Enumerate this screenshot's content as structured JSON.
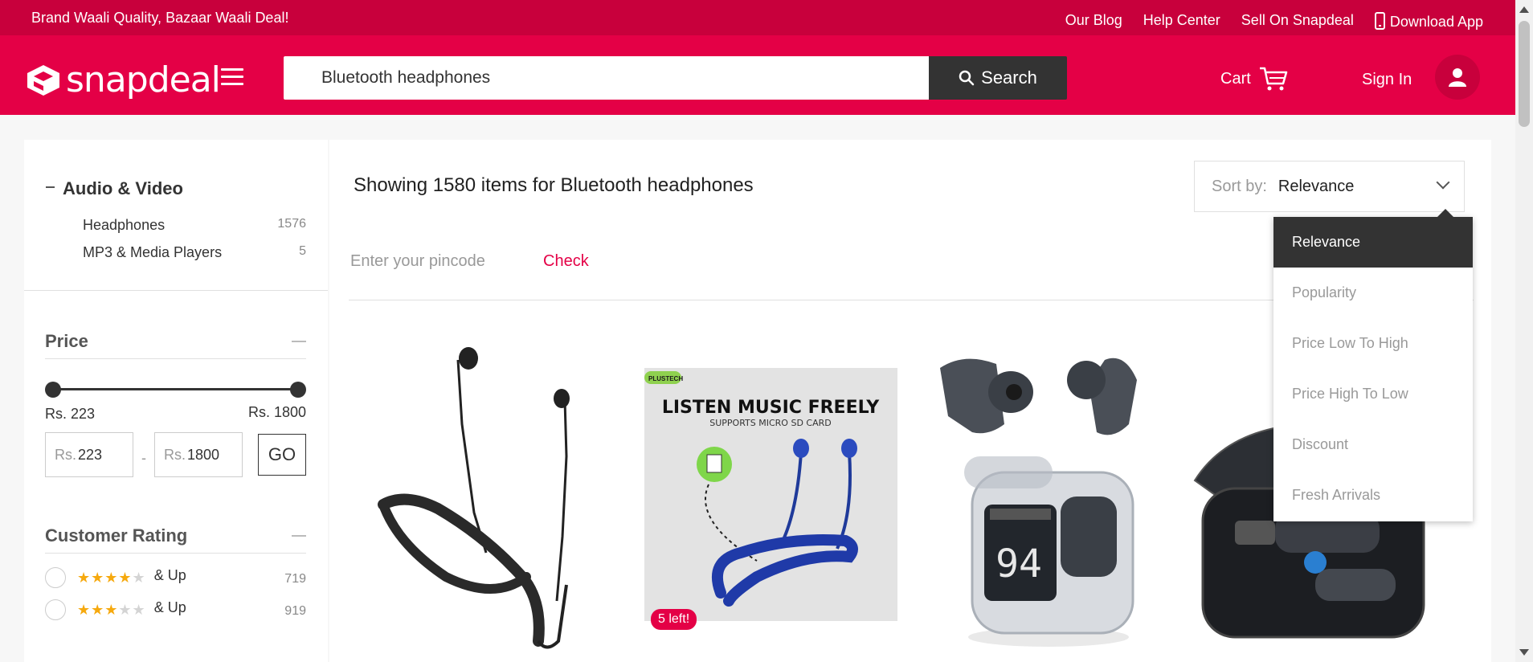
{
  "top_bar": {
    "tagline": "Brand Waali Quality, Bazaar Waali Deal!",
    "links": [
      "Our Blog",
      "Help Center",
      "Sell On Snapdeal",
      "Download App"
    ]
  },
  "header": {
    "logo_text": "snapdeal",
    "search_value": "Bluetooth headphones",
    "search_button": "Search",
    "cart_label": "Cart",
    "signin_label": "Sign In"
  },
  "sidebar": {
    "category": {
      "title": "Audio & Video",
      "items": [
        {
          "label": "Headphones",
          "count": "1576"
        },
        {
          "label": "MP3 & Media Players",
          "count": "5"
        }
      ]
    },
    "price": {
      "title": "Price",
      "min_label": "Rs. 223",
      "max_label": "Rs. 1800",
      "input_prefix": "Rs.",
      "min_value": "223",
      "max_value": "1800",
      "range_separator": "-",
      "go_label": "GO"
    },
    "rating": {
      "title": "Customer Rating",
      "rows": [
        {
          "stars": 4,
          "label": "& Up",
          "count": "719"
        },
        {
          "stars": 3,
          "label": "& Up",
          "count": "919"
        }
      ]
    }
  },
  "main": {
    "showing_text": "Showing 1580 items for Bluetooth headphones",
    "sort_label": "Sort by:",
    "sort_value": "Relevance",
    "pincode_placeholder": "Enter your pincode",
    "check_label": "Check",
    "sort_options": [
      "Relevance",
      "Popularity",
      "Price Low To High",
      "Price High To Low",
      "Discount",
      "Fresh Arrivals"
    ],
    "products": [
      {
        "image": "black neckband earphones"
      },
      {
        "image": "blue neckband earphones",
        "banner_title": "LISTEN MUSIC FREELY",
        "banner_subtitle": "SUPPORTS MICRO SD CARD",
        "brand_tag": "PLUSTECH",
        "badge": "5 left!"
      },
      {
        "image": "transparent earbuds case",
        "display": "94"
      },
      {
        "image": "black earbuds case"
      }
    ]
  },
  "colors": {
    "brand": "#e40046",
    "brand_dark": "#c8003c",
    "dark": "#333333"
  }
}
